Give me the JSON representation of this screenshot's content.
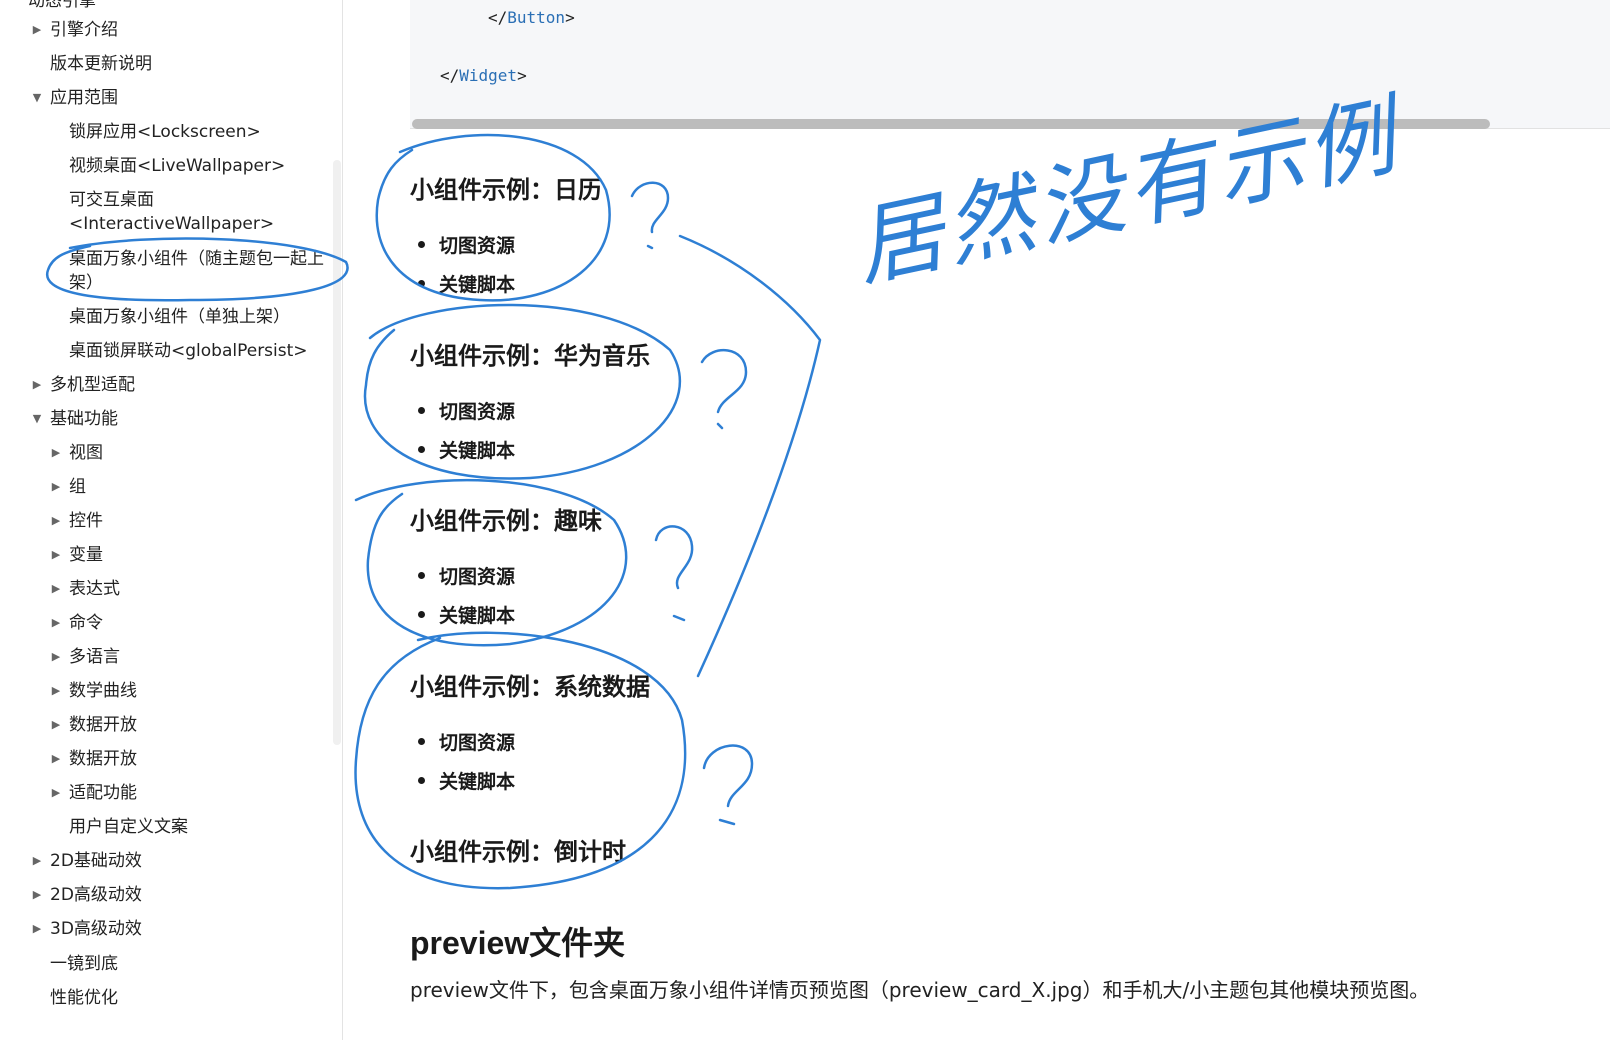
{
  "sidebar": {
    "truncated_top": "动态引擎",
    "items": [
      {
        "label": "引擎介绍",
        "caret": "right"
      },
      {
        "label": "版本更新说明",
        "caret": ""
      },
      {
        "label": "应用范围",
        "caret": "down"
      },
      {
        "label": "锁屏应用<Lockscreen>",
        "caret": ""
      },
      {
        "label": "视频桌面<LiveWallpaper>",
        "caret": ""
      },
      {
        "label": "可交互桌面<InteractiveWallpaper>",
        "caret": ""
      },
      {
        "label": "桌面万象小组件（随主题包一起上架）",
        "caret": ""
      },
      {
        "label": "桌面万象小组件（单独上架）",
        "caret": ""
      },
      {
        "label": "桌面锁屏联动<globalPersist>",
        "caret": ""
      },
      {
        "label": "多机型适配",
        "caret": "right"
      },
      {
        "label": "基础功能",
        "caret": "down"
      },
      {
        "label": "视图",
        "caret": "right"
      },
      {
        "label": "组",
        "caret": "right"
      },
      {
        "label": "控件",
        "caret": "right"
      },
      {
        "label": "变量",
        "caret": "right"
      },
      {
        "label": "表达式",
        "caret": "right"
      },
      {
        "label": "命令",
        "caret": "right"
      },
      {
        "label": "多语言",
        "caret": "right"
      },
      {
        "label": "数学曲线",
        "caret": "right"
      },
      {
        "label": "数据开放",
        "caret": "right"
      },
      {
        "label": "数据开放",
        "caret": "right"
      },
      {
        "label": "适配功能",
        "caret": "right"
      },
      {
        "label": "用户自定义文案",
        "caret": ""
      },
      {
        "label": "2D基础动效",
        "caret": "right"
      },
      {
        "label": "2D高级动效",
        "caret": "right"
      },
      {
        "label": "3D高级动效",
        "caret": "right"
      },
      {
        "label": "一镜到底",
        "caret": ""
      },
      {
        "label": "性能优化",
        "caret": ""
      }
    ]
  },
  "code": {
    "line1_open": "</",
    "line1_tag": "Button",
    "line1_close": ">",
    "line2_open": "</",
    "line2_tag": "Widget",
    "line2_close": ">"
  },
  "sections": [
    {
      "title": "小组件示例：日历",
      "bullets": [
        "切图资源",
        "关键脚本"
      ]
    },
    {
      "title": "小组件示例：华为音乐",
      "bullets": [
        "切图资源",
        "关键脚本"
      ]
    },
    {
      "title": "小组件示例：趣味",
      "bullets": [
        "切图资源",
        "关键脚本"
      ]
    },
    {
      "title": "小组件示例：系统数据",
      "bullets": [
        "切图资源",
        "关键脚本"
      ]
    },
    {
      "title": "小组件示例：倒计时",
      "bullets": []
    }
  ],
  "preview": {
    "heading": "preview文件夹",
    "paragraph": "preview文件下，包含桌面万象小组件详情页预览图（preview_card_X.jpg）和手机大/小主题包其他模块预览图。"
  },
  "annotation": {
    "text": "居然没有示例",
    "question_mark": "?",
    "color": "#2e7fd4"
  }
}
